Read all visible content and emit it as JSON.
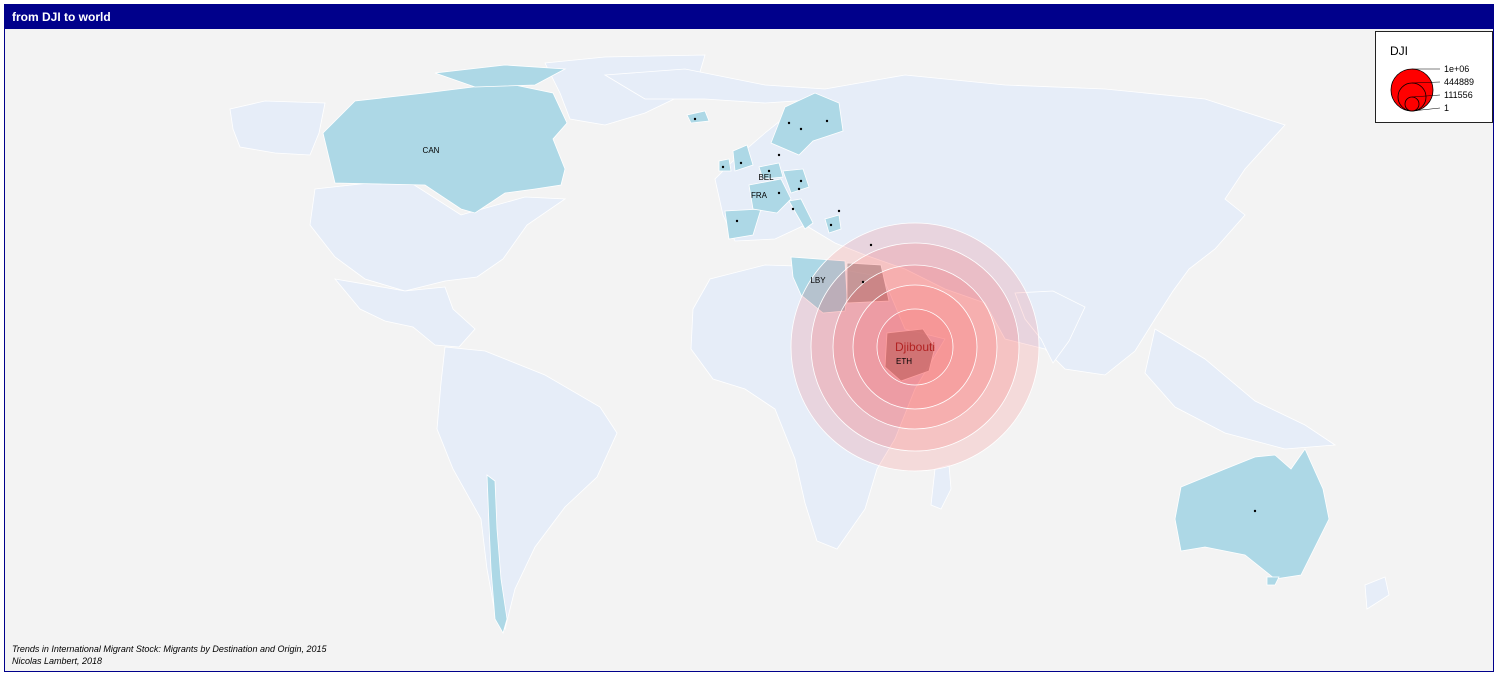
{
  "header": {
    "title": "from DJI to world"
  },
  "colors": {
    "frame": "#00008b",
    "ocean": "#f3f3f3",
    "land": "#e6edf8",
    "destination": "#add8e6",
    "origin": "#a9a9a9",
    "symbol": "#ff0000"
  },
  "origin": {
    "code": "DJI",
    "name": "Djibouti"
  },
  "country_labels": [
    {
      "code": "CAN"
    },
    {
      "code": "BEL"
    },
    {
      "code": "FRA"
    },
    {
      "code": "LBY"
    },
    {
      "code": "ETH"
    }
  ],
  "legend": {
    "title": "DJI",
    "values": [
      "1e+06",
      "444889",
      "111556",
      "1"
    ]
  },
  "credits": {
    "source": "Trends in International Migrant Stock: Migrants by Destination and Origin, 2015",
    "author": "Nicolas Lambert, 2018"
  }
}
